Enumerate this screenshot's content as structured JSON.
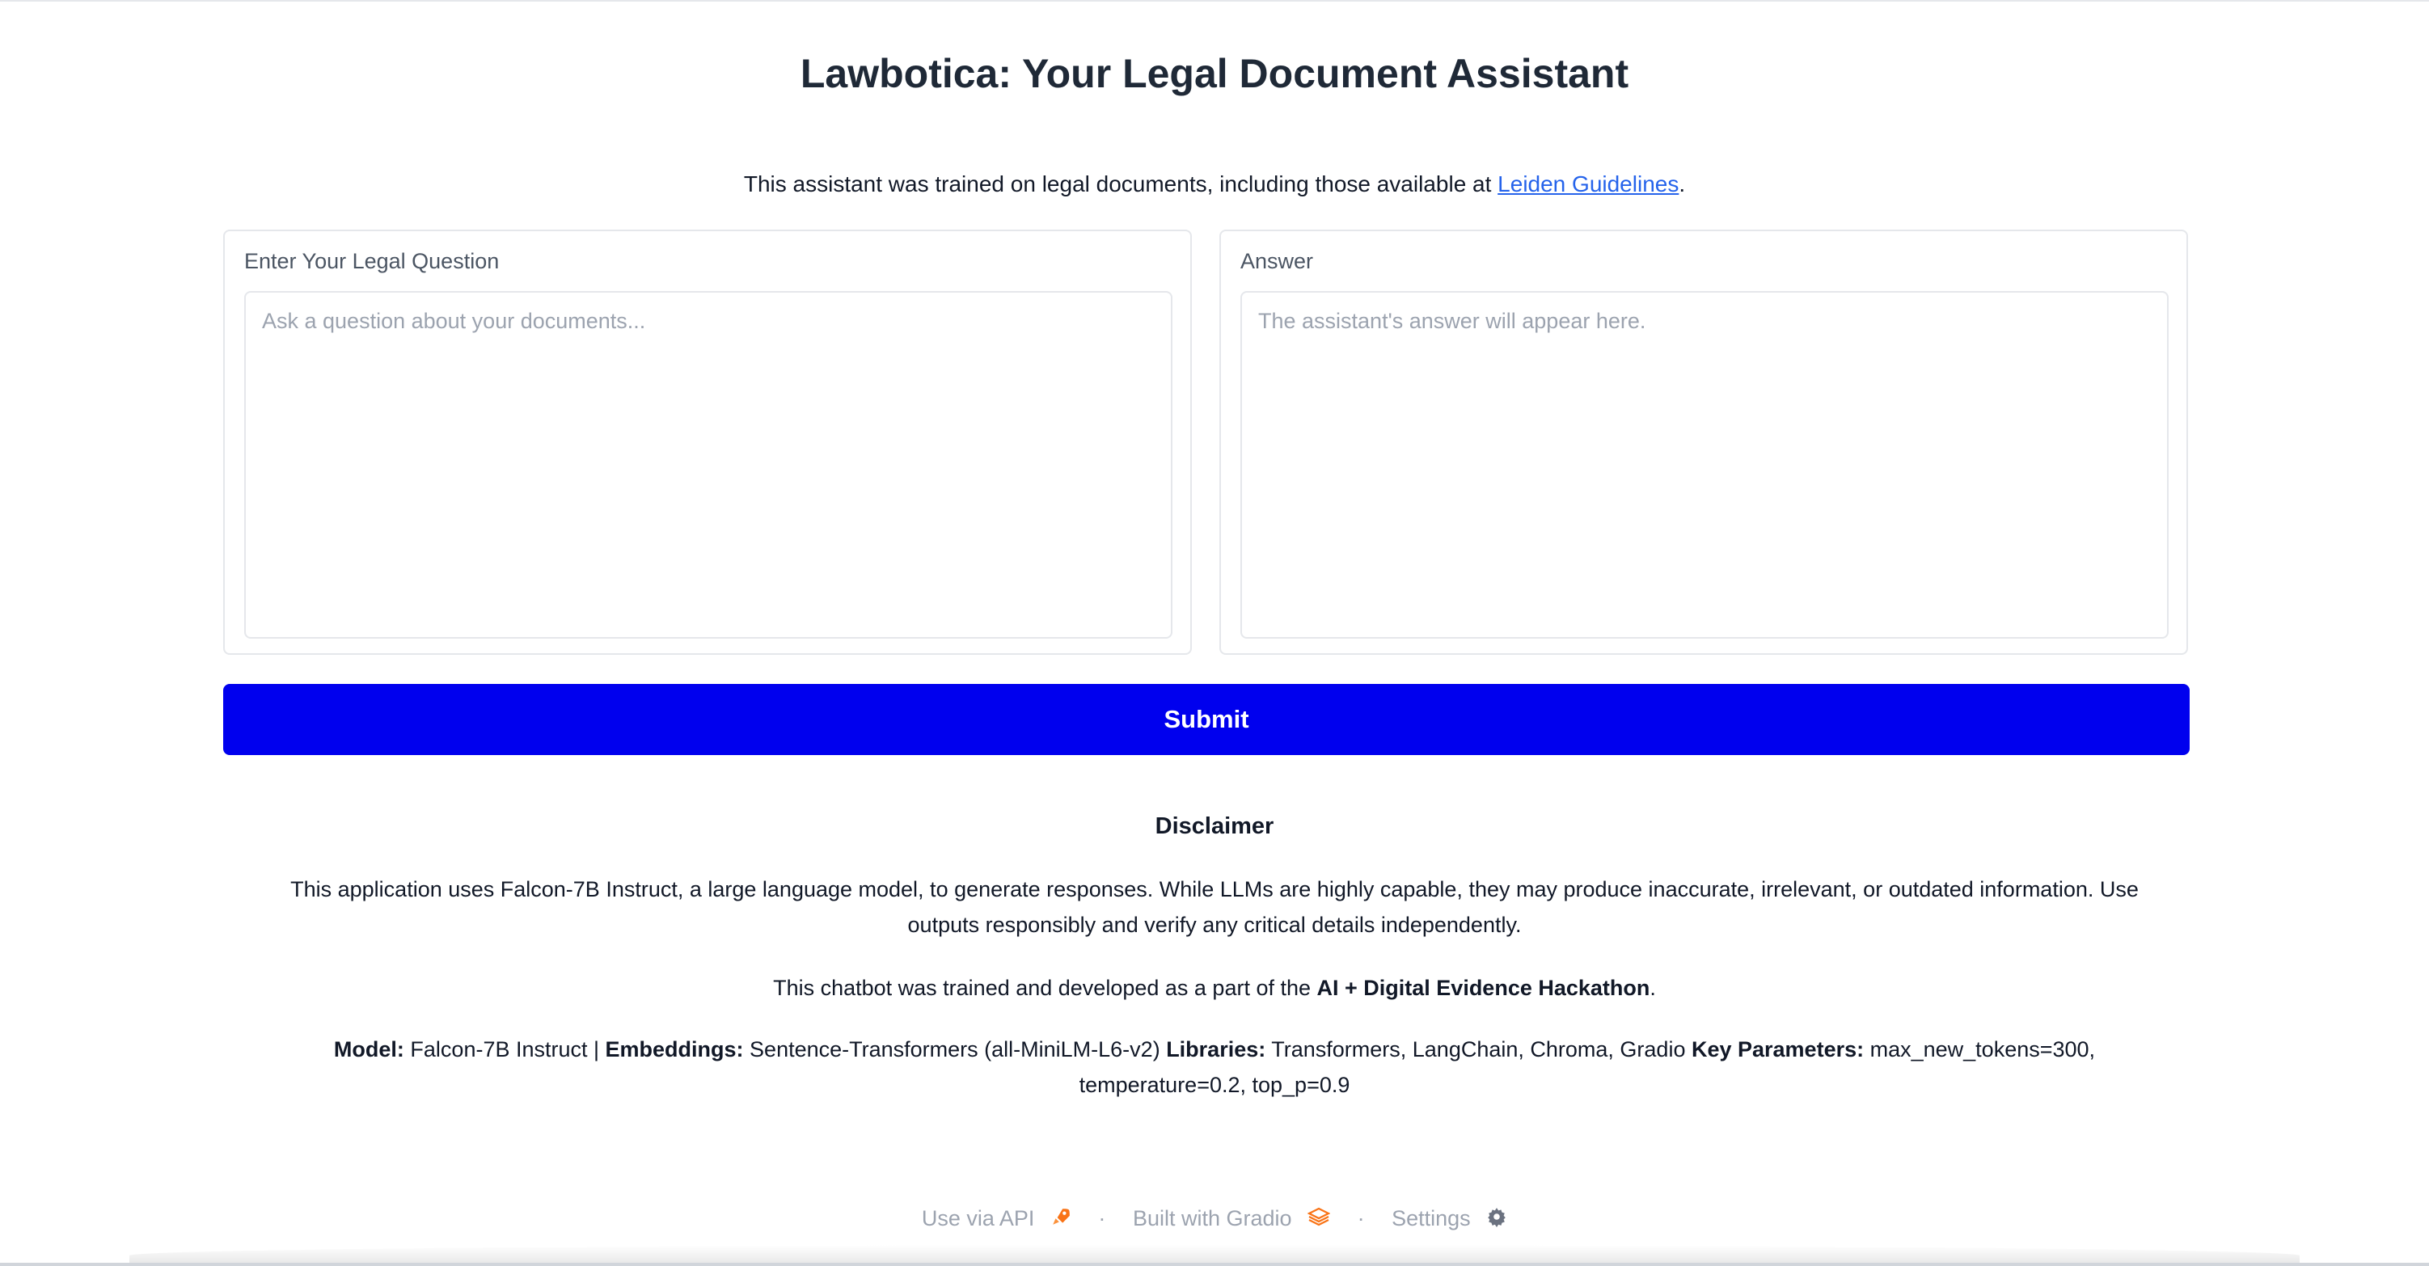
{
  "header": {
    "title": "Lawbotica: Your Legal Document Assistant",
    "intro_prefix": "This assistant was trained on legal documents, including those available at ",
    "intro_link": "Leiden Guidelines",
    "intro_suffix": "."
  },
  "question_panel": {
    "label": "Enter Your Legal Question",
    "value": "",
    "placeholder": "Ask a question about your documents..."
  },
  "answer_panel": {
    "label": "Answer",
    "value": "",
    "placeholder": "The assistant's answer will appear here."
  },
  "submit_label": "Submit",
  "disclaimer": {
    "title": "Disclaimer",
    "text": "This application uses Falcon-7B Instruct, a large language model, to generate responses. While LLMs are highly capable, they may produce inaccurate, irrelevant, or outdated information. Use outputs responsibly and verify any critical details independently.",
    "hackathon_prefix": "This chatbot was trained and developed as a part of the ",
    "hackathon_name": "AI + Digital Evidence Hackathon",
    "hackathon_suffix": "."
  },
  "tech": {
    "model_label": "Model:",
    "model_value": " Falcon-7B Instruct | ",
    "embeddings_label": "Embeddings:",
    "embeddings_value": " Sentence-Transformers (all-MiniLM-L6-v2) ",
    "libraries_label": "Libraries:",
    "libraries_value": " Transformers, LangChain, Chroma, Gradio ",
    "params_label": "Key Parameters:",
    "params_value": " max_new_tokens=300, temperature=0.2, top_p=0.9"
  },
  "footer": {
    "api_label": "Use via API",
    "separator": "·",
    "gradio_label": "Built with Gradio",
    "settings_label": "Settings"
  },
  "icons": {
    "api": "rocket-icon",
    "gradio": "gradio-logo-icon",
    "settings": "gear-icon"
  },
  "colors": {
    "submit_bg": "#0000ee",
    "link": "#2563eb"
  }
}
